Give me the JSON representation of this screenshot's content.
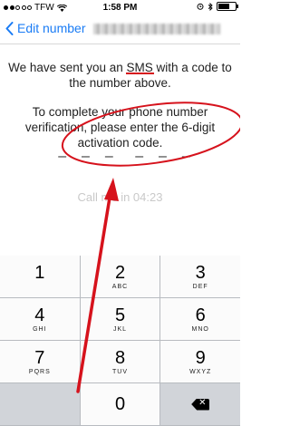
{
  "status_bar": {
    "carrier": "TFW",
    "time": "1:58 PM"
  },
  "nav": {
    "back_label": "Edit number"
  },
  "message": {
    "line1_before": "We have sent you an ",
    "sms": "SMS",
    "line1_after": " with a code to the number above.",
    "instruction": "To complete your phone number verification, please enter the 6-digit activation code."
  },
  "code_slots": [
    "–",
    "–",
    "–",
    "–",
    "–",
    "–"
  ],
  "call_timer": "Call me in 04:23",
  "keypad": {
    "rows": [
      [
        {
          "digit": "1",
          "letters": ""
        },
        {
          "digit": "2",
          "letters": "ABC"
        },
        {
          "digit": "3",
          "letters": "DEF"
        }
      ],
      [
        {
          "digit": "4",
          "letters": "GHI"
        },
        {
          "digit": "5",
          "letters": "JKL"
        },
        {
          "digit": "6",
          "letters": "MNO"
        }
      ],
      [
        {
          "digit": "7",
          "letters": "PQRS"
        },
        {
          "digit": "8",
          "letters": "TUV"
        },
        {
          "digit": "9",
          "letters": "WXYZ"
        }
      ],
      [
        {
          "digit": "",
          "letters": ""
        },
        {
          "digit": "0",
          "letters": ""
        },
        {
          "digit": "",
          "letters": ""
        }
      ]
    ]
  },
  "colors": {
    "accent": "#1a7cf5",
    "annotation": "#d6121c"
  }
}
